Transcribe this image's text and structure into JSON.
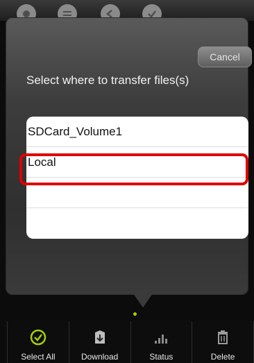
{
  "dialog": {
    "cancel_label": "Cancel",
    "prompt": "Select where to transfer files(s)",
    "destinations": [
      "SDCard_Volume1",
      "Local",
      "",
      ""
    ]
  },
  "toolbar": {
    "items": [
      {
        "label": "Select All",
        "icon": "checkmark-circle-icon"
      },
      {
        "label": "Download",
        "icon": "download-icon"
      },
      {
        "label": "Status",
        "icon": "signal-bars-icon"
      },
      {
        "label": "Delete",
        "icon": "trash-icon"
      }
    ]
  },
  "colors": {
    "highlight": "#e00000",
    "select_icon": "#a7d000"
  }
}
